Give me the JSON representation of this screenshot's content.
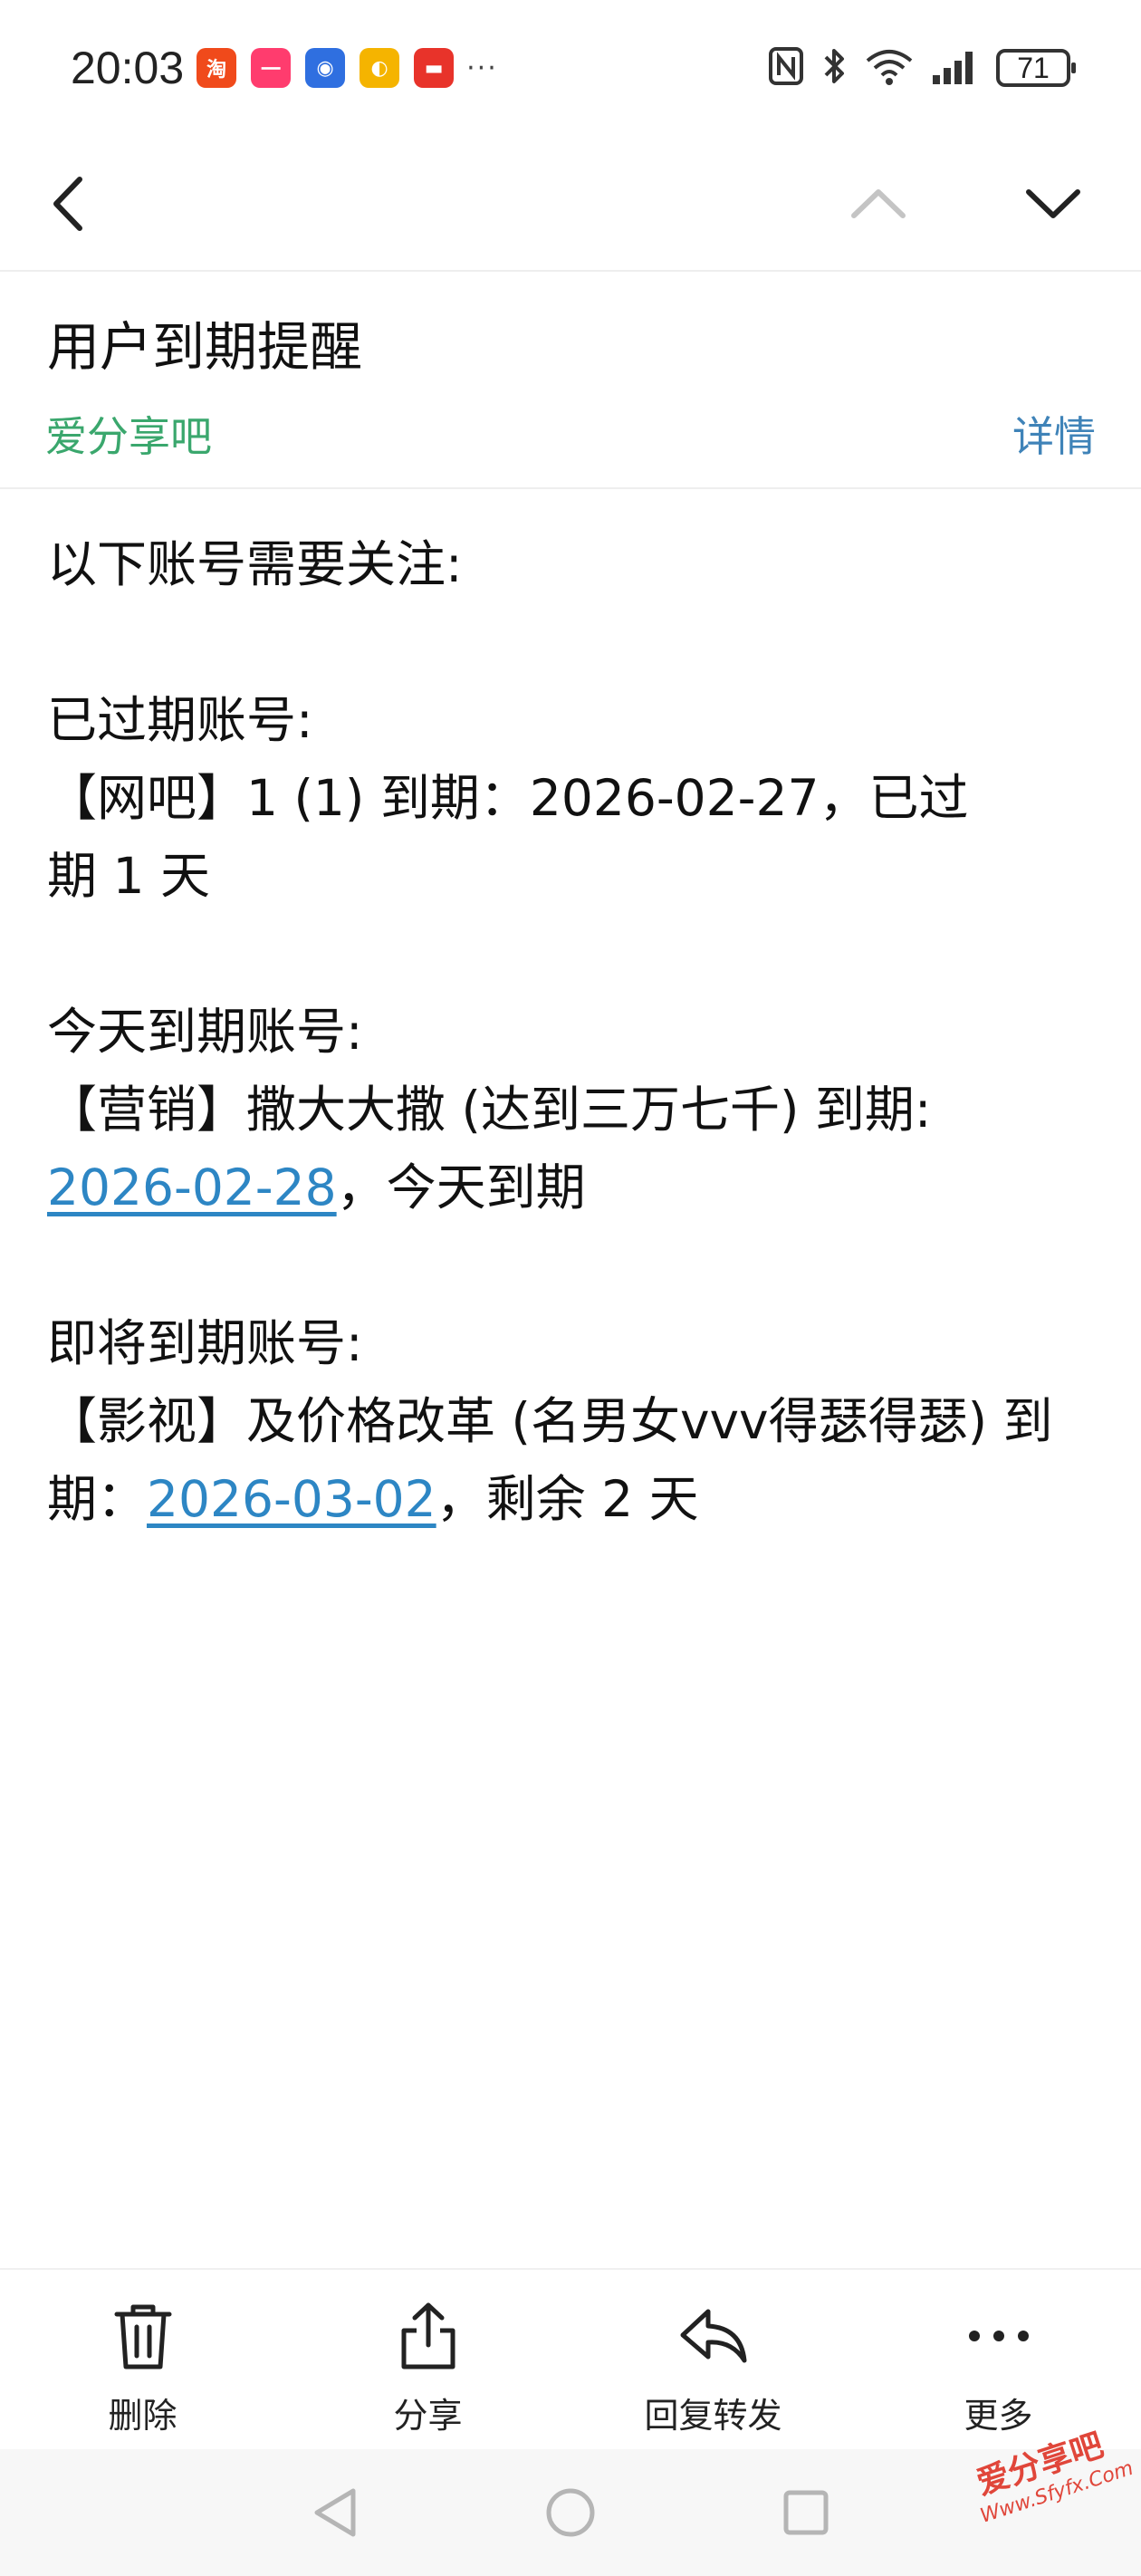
{
  "status_bar": {
    "time": "20:03",
    "battery": "71",
    "app_icons": [
      {
        "name": "taobao-app-icon",
        "color": "#f04a1b",
        "glyph": "淘"
      },
      {
        "name": "yiyuan-app-icon",
        "color": "#ff3c6e",
        "glyph": "一"
      },
      {
        "name": "blue-app-icon",
        "color": "#2f6fe0",
        "glyph": "◉"
      },
      {
        "name": "yellow-app-icon",
        "color": "#f5b400",
        "glyph": "◐"
      },
      {
        "name": "huawei-app-icon",
        "color": "#e8332a",
        "glyph": "▬"
      }
    ],
    "more": "···"
  },
  "email": {
    "subject": "用户到期提醒",
    "sender": "爱分享吧",
    "details": "详情",
    "body": {
      "intro": "以下账号需要关注:",
      "expired_heading": "已过期账号:",
      "expired_line1": "【网吧】1 (1) 到期：2026-02-27，已过",
      "expired_line2": "期 1 天",
      "today_heading": "今天到期账号:",
      "today_line1": "【营销】撒大大撒 (达到三万七千) 到期:",
      "today_date": "2026-02-28",
      "today_suffix": "，今天到期",
      "soon_heading": "即将到期账号:",
      "soon_line1": "【影视】及价格改革 (名男女vvv得瑟得瑟) 到",
      "soon_prefix": "期：",
      "soon_date": "2026-03-02",
      "soon_suffix": "，剩余 2 天"
    }
  },
  "actions": {
    "delete": "删除",
    "share": "分享",
    "reply_forward": "回复转发",
    "more": "更多"
  },
  "watermark": {
    "cn": "爱分享吧",
    "en": "Www.Sfyfx.Com"
  },
  "colors": {
    "sender_green": "#3aa76d",
    "link_blue": "#2d86c4",
    "details_blue": "#3f83b8"
  }
}
